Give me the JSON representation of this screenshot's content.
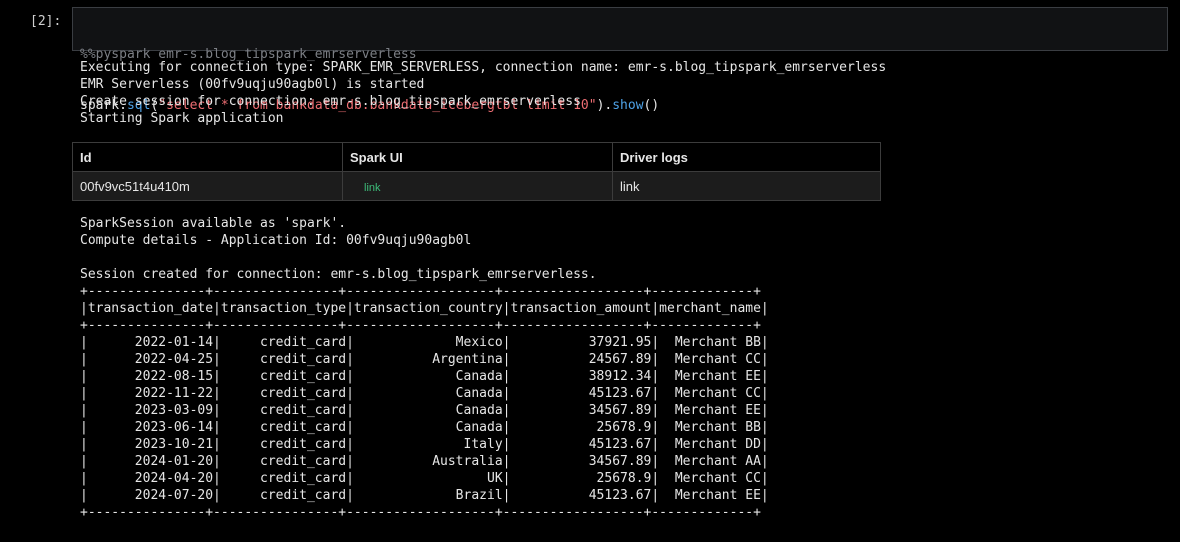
{
  "cell": {
    "prompt": "[2]:",
    "magic_line": "%%pyspark emr-s.blog_tipspark_emrserverless",
    "code": {
      "obj": "spark",
      "dot1": ".",
      "func": "sql",
      "open": "(",
      "query": "\"select * from bankdata_db.bankdata_icebergtbl limit 10\"",
      "close": ").",
      "method": "show",
      "end": "()"
    }
  },
  "log_lines": [
    "Executing for connection type: SPARK_EMR_SERVERLESS, connection name: emr-s.blog_tipspark_emrserverless",
    "EMR Serverless (00fv9uqju90agb0l) is started",
    "Create session for connection: emr-s.blog_tipspark_emrserverless",
    "Starting Spark application"
  ],
  "session_table": {
    "headers": [
      "Id",
      "Spark UI",
      "Driver logs"
    ],
    "id": "00fv9vc51t4u410m",
    "spark_ui_link": "link",
    "driver_logs_link": "link"
  },
  "session_lines": [
    "SparkSession available as 'spark'.",
    "Compute details - Application Id: 00fv9uqju90agb0l",
    "",
    "Session created for connection: emr-s.blog_tipspark_emrserverless."
  ],
  "result": {
    "separator": "+---------------+----------------+-------------------+------------------+-------------+",
    "columns": [
      "transaction_date",
      "transaction_type",
      "transaction_country",
      "transaction_amount",
      "merchant_name"
    ],
    "rows": [
      [
        "2022-01-14",
        "credit_card",
        "Mexico",
        "37921.95",
        "Merchant BB"
      ],
      [
        "2022-04-25",
        "credit_card",
        "Argentina",
        "24567.89",
        "Merchant CC"
      ],
      [
        "2022-08-15",
        "credit_card",
        "Canada",
        "38912.34",
        "Merchant EE"
      ],
      [
        "2022-11-22",
        "credit_card",
        "Canada",
        "45123.67",
        "Merchant CC"
      ],
      [
        "2023-03-09",
        "credit_card",
        "Canada",
        "34567.89",
        "Merchant EE"
      ],
      [
        "2023-06-14",
        "credit_card",
        "Canada",
        "25678.9",
        "Merchant BB"
      ],
      [
        "2023-10-21",
        "credit_card",
        "Italy",
        "45123.67",
        "Merchant DD"
      ],
      [
        "2024-01-20",
        "credit_card",
        "Australia",
        "34567.89",
        "Merchant AA"
      ],
      [
        "2024-04-20",
        "credit_card",
        "UK",
        "25678.9",
        "Merchant CC"
      ],
      [
        "2024-07-20",
        "credit_card",
        "Brazil",
        "45123.67",
        "Merchant EE"
      ]
    ]
  }
}
